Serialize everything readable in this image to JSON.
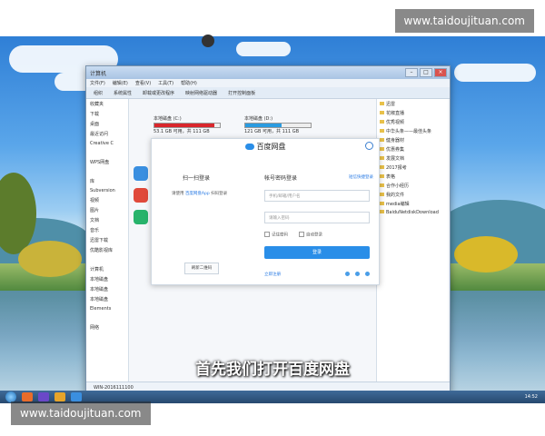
{
  "watermark": {
    "top": "www.taidoujituan.com",
    "bottom": "www.taidoujituan.com"
  },
  "subtitle": "首先我们打开百度网盘",
  "baidu_login": {
    "window_title": "百度网盘",
    "qr_title": "扫一扫登录",
    "qr_desc_prefix": "请使用",
    "qr_desc_link": "百度网盘App",
    "qr_desc_suffix": "扫码登录",
    "qr_button": "刷新二维码",
    "account_title": "帐号密码登录",
    "account_help": "短信快捷登录",
    "phone_placeholder": "手机/邮箱/用户名",
    "password_placeholder": "请输入密码",
    "remember": "记住密码",
    "auto_login": "自动登录",
    "login_button": "登录",
    "register_link": "立即注册"
  },
  "explorer": {
    "title": "计算机",
    "menus": [
      "文件(F)",
      "编辑(E)",
      "查看(V)",
      "工具(T)",
      "帮助(H)"
    ],
    "toolbar": [
      "组织",
      "系统属性",
      "卸载或更改程序",
      "映射网络驱动器",
      "打开控制面板"
    ],
    "sidebar": [
      "收藏夹",
      "下载",
      "桌面",
      "最近访问",
      "Creative C",
      "",
      "WPS网盘",
      "",
      "库",
      "Subversion",
      "视频",
      "图片",
      "文档",
      "音乐",
      "迅雷下载",
      "优酷影视库",
      "",
      "计算机",
      "本地磁盘",
      "本地磁盘",
      "本地磁盘",
      "Elements",
      "",
      "网络"
    ],
    "drives": [
      {
        "label": "本地磁盘 (C:)",
        "info": "53.1 GB 可用，共 111 GB"
      },
      {
        "label": "本地磁盘 (D:)",
        "info": "121 GB 可用，共 111 GB"
      }
    ],
    "right_list": [
      "迅雷",
      "花椒直播",
      "优秀视频",
      "中华头条——最佳头条",
      "健身器材",
      "优惠券集",
      "发展文档",
      "2017报考",
      "表格",
      "合作小经历",
      "我的文件",
      "media编辑",
      "BaiduNetdiskDownload"
    ],
    "status": "WIN-2016111100"
  },
  "taskbar": {
    "clock": "14:52"
  }
}
